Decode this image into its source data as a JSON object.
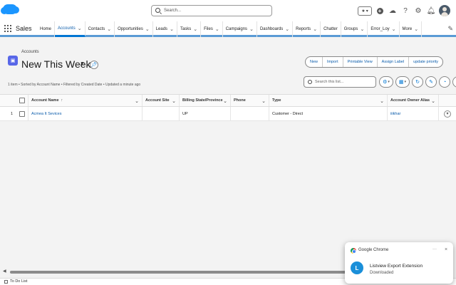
{
  "header": {
    "search_placeholder": "Search...",
    "icons": [
      "favorites-star-icon",
      "add-icon",
      "trailhead-icon",
      "help-icon",
      "setup-gear-icon",
      "notifications-bell-icon",
      "user-avatar"
    ]
  },
  "nav": {
    "app_name": "Sales",
    "items": [
      {
        "label": "Home",
        "chevron": false
      },
      {
        "label": "Accounts",
        "chevron": true,
        "active": true
      },
      {
        "label": "Contacts",
        "chevron": true
      },
      {
        "label": "Opportunities",
        "chevron": true
      },
      {
        "label": "Leads",
        "chevron": true
      },
      {
        "label": "Tasks",
        "chevron": true
      },
      {
        "label": "Files",
        "chevron": true
      },
      {
        "label": "Campaigns",
        "chevron": true
      },
      {
        "label": "Dashboards",
        "chevron": true
      },
      {
        "label": "Reports",
        "chevron": true
      },
      {
        "label": "Chatter",
        "chevron": false
      },
      {
        "label": "Groups",
        "chevron": true
      },
      {
        "label": "Error_Loy",
        "chevron": true
      },
      {
        "label": "More",
        "chevron": true
      }
    ]
  },
  "page_header": {
    "object_label": "Accounts",
    "list_view_name": "New This Week",
    "info": "1 item • Sorted by Account Name • Filtered by Created Date • Updated a minute ago"
  },
  "actions": [
    "New",
    "Import",
    "Printable View",
    "Assign Label",
    "update priority"
  ],
  "list_search_placeholder": "Search this list...",
  "table": {
    "columns": [
      {
        "label": "Account Name",
        "sorted": true
      },
      {
        "label": "Account Site"
      },
      {
        "label": "Billing State/Province"
      },
      {
        "label": "Phone"
      },
      {
        "label": "Type"
      },
      {
        "label": "Account Owner Alias"
      }
    ],
    "rows": [
      {
        "num": "1",
        "account_name": "Acmea It Sevices",
        "account_site": "",
        "billing_state": "UP",
        "phone": "",
        "type": "Customer - Direct",
        "owner_alias": "iiikhar"
      }
    ]
  },
  "footer": {
    "utility_label": "To Do List"
  },
  "notification": {
    "source": "Google Chrome",
    "title": "Listview Export Extension",
    "subtitle": "Downloaded",
    "more": "···",
    "close": "×"
  },
  "colors": {
    "brand_blue": "#0176d3",
    "link_blue": "#0b5cab",
    "nav_accent": "#5a9bd5",
    "object_icon": "#5867e8"
  }
}
